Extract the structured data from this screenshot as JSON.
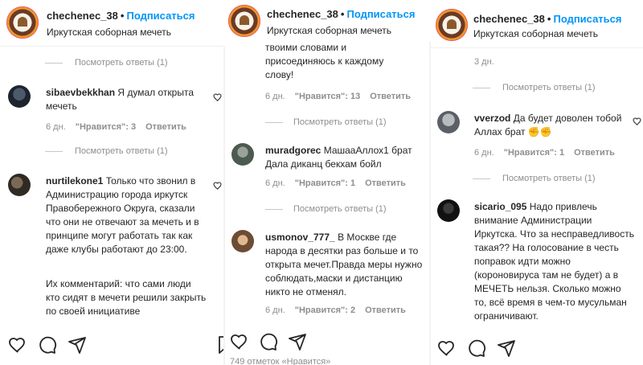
{
  "account": {
    "username": "chechenec_38",
    "dot": "•",
    "follow_label": "Подписаться",
    "location": "Иркутская соборная мечеть"
  },
  "labels": {
    "view_replies_1": "Посмотреть ответы (1)",
    "reply": "Ответить",
    "days_6": "6 дн.",
    "days_3": "3 дн."
  },
  "panel1": {
    "comments": [
      {
        "user": "sibaevbekkhan",
        "text": "Я думал открыта мечеть",
        "time": "6 дн.",
        "likes": "\"Нравится\": 3"
      },
      {
        "user": "nurtilekone1",
        "text": "Только что звонил в Администрацию города иркутск Правобережного Округа, сказали что они не отвечают за мечеть и в принципе могут работать так как даже клубы работают до 23:00.",
        "text2": "Их комментарий: что сами люди кто сидят в мечети решили закрыть по своей инициативе"
      }
    ]
  },
  "panel2": {
    "partial_text": "твоими словами и присоединяюсь к каждому слову!",
    "partial_likes": "\"Нравится\": 13",
    "comments": [
      {
        "user": "muradgorec",
        "text": "МашааАллох1 брат Дала диканц бекхам бойл",
        "time": "6 дн.",
        "likes": "\"Нравится\": 1"
      },
      {
        "user": "usmonov_777_",
        "text": "В Москве где народа в десятки раз больше и то открыта мечет.Правда меры нужно соблюдать,маски и дистанцию никто не отменял.",
        "time": "6 дн.",
        "likes": "\"Нравится\": 2"
      }
    ],
    "bottom_cut": "749 отметок «Нравится»"
  },
  "panel3": {
    "comments": [
      {
        "user": "vverzod",
        "text": "Да будет доволен тобой Аллах брат",
        "emoji": "✊✊",
        "time": "6 дн.",
        "likes": "\"Нравится\": 1"
      },
      {
        "user": "sicario_095",
        "text": "Надо привлечь внимание Администрации Иркутска. Что за несправедливость такая?? На голосование в честь поправок идти можно (короновируса там не будет) а в МЕЧЕТЬ нельзя. Сколько можно то, всё время в чем-то мусульман ограничивают."
      }
    ]
  },
  "colors": {
    "link": "#0095f6",
    "muted": "#8e8e8e",
    "text": "#262626"
  },
  "icons": [
    "heart-icon",
    "comment-icon",
    "share-icon",
    "bookmark-icon"
  ]
}
